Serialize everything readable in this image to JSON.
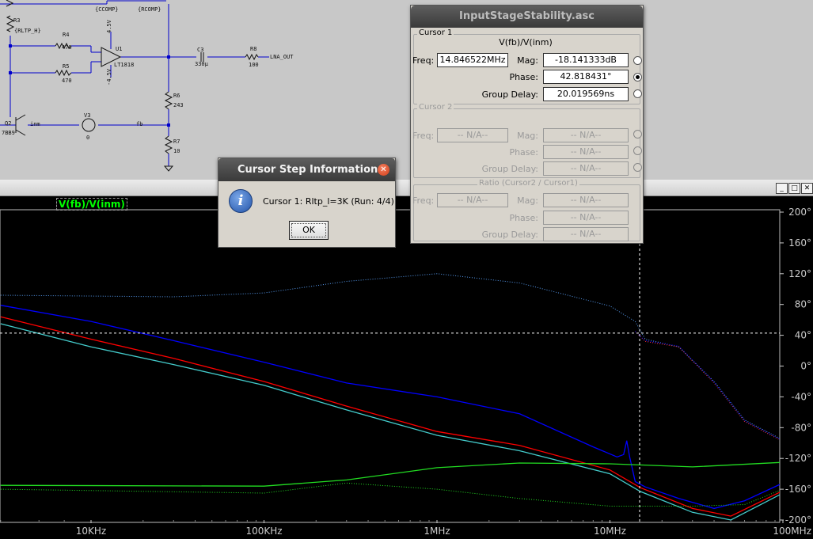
{
  "schematic": {
    "labels": {
      "r3": "R3",
      "rltp_h": "{RLTP_H}",
      "ccomp": "{CCOMP}",
      "rcomp": "{RCOMP}",
      "r4": "R4",
      "r4v": "470",
      "r5": "R5",
      "r5v": "470",
      "vp": "4.5V",
      "vn": "-4.5V",
      "u1": "U1",
      "u1part": "LT1818",
      "c3": "C3",
      "c3v": "330µ",
      "r8": "R8",
      "r8v": "100",
      "lna_out": "LNA_OUT",
      "r6": "R6",
      "r6v": "243",
      "r7": "R7",
      "r7v": "10",
      "q2": "Q2",
      "q2part": "7BB9",
      "inm": "inm",
      "v3": "V3",
      "v3v": "0",
      "fb": "fb"
    }
  },
  "wave_window": {
    "trace_label": "V(fb)/V(inm)",
    "buttons": {
      "minimize": "_",
      "maximize": "□",
      "close": "✕"
    }
  },
  "cursor_dialog": {
    "title": "InputStageStability.asc",
    "cursor1": {
      "group_title": "Cursor 1",
      "expr": "V(fb)/V(inm)",
      "freq_label": "Freq:",
      "freq_value": "14.846522MHz",
      "mag_label": "Mag:",
      "mag_value": "-18.141333dB",
      "phase_label": "Phase:",
      "phase_value": "42.818431°",
      "gd_label": "Group Delay:",
      "gd_value": "20.019569ns"
    },
    "cursor2": {
      "group_title": "Cursor 2",
      "freq_label": "Freq:",
      "freq_value": "-- N/A--",
      "mag_label": "Mag:",
      "mag_value": "-- N/A--",
      "phase_label": "Phase:",
      "phase_value": "-- N/A--",
      "gd_label": "Group Delay:",
      "gd_value": "-- N/A--"
    },
    "ratio": {
      "group_title": "Ratio (Cursor2 / Cursor1)",
      "freq_label": "Freq:",
      "freq_value": "-- N/A--",
      "mag_label": "Mag:",
      "mag_value": "-- N/A--",
      "phase_label": "Phase:",
      "phase_value": "-- N/A--",
      "gd_label": "Group Delay:",
      "gd_value": "-- N/A--"
    }
  },
  "step_dialog": {
    "title": "Cursor Step Information",
    "icon": "info-icon",
    "message": "Cursor 1: Rltp_l=3K  (Run: 4/4)",
    "ok_label": "OK",
    "close_glyph": "✕"
  },
  "chart_data": {
    "type": "line",
    "x_scale": "log",
    "x_ticks": [
      "10KHz",
      "100KHz",
      "1MHz",
      "10MHz",
      "100MHz"
    ],
    "y_right_ticks": [
      "200°",
      "160°",
      "120°",
      "80°",
      "40°",
      "0°",
      "-40°",
      "-80°",
      "-120°",
      "-160°",
      "-200°"
    ],
    "y_right_range": [
      -200,
      200
    ],
    "cursor": {
      "freq_hz": 14846522,
      "phase_deg": 42.818431
    },
    "colors": {
      "background": "#000000",
      "grid": "#bbbbbb",
      "ticks": "#cccccc",
      "cursor": "#ffffff"
    },
    "series": [
      {
        "color": "#0000ff",
        "style": "solid",
        "points": [
          [
            3000,
            79
          ],
          [
            10000,
            58
          ],
          [
            30000,
            33
          ],
          [
            100000,
            5
          ],
          [
            300000,
            -22
          ],
          [
            1000000,
            -40
          ],
          [
            3000000,
            -62
          ],
          [
            8000000,
            -105
          ],
          [
            11000000,
            -118
          ],
          [
            12000000,
            -115
          ],
          [
            12500000,
            -97
          ],
          [
            13000000,
            -118
          ],
          [
            14000000,
            -150
          ],
          [
            16000000,
            -157
          ],
          [
            25000000,
            -172
          ],
          [
            40000000,
            -185
          ],
          [
            60000000,
            -175
          ],
          [
            100000000,
            -152
          ]
        ]
      },
      {
        "color": "#ff0000",
        "style": "solid",
        "points": [
          [
            3000,
            64
          ],
          [
            10000,
            35
          ],
          [
            30000,
            10
          ],
          [
            100000,
            -20
          ],
          [
            300000,
            -52
          ],
          [
            1000000,
            -85
          ],
          [
            3000000,
            -103
          ],
          [
            10000000,
            -135
          ],
          [
            15000000,
            -158
          ],
          [
            30000000,
            -185
          ],
          [
            50000000,
            -195
          ],
          [
            100000000,
            -162
          ]
        ]
      },
      {
        "color": "#44cccc",
        "style": "solid",
        "points": [
          [
            3000,
            55
          ],
          [
            10000,
            25
          ],
          [
            30000,
            2
          ],
          [
            100000,
            -25
          ],
          [
            300000,
            -57
          ],
          [
            1000000,
            -90
          ],
          [
            3000000,
            -110
          ],
          [
            10000000,
            -140
          ],
          [
            15000000,
            -163
          ],
          [
            30000000,
            -190
          ],
          [
            50000000,
            -200
          ],
          [
            100000000,
            -165
          ]
        ]
      },
      {
        "color": "#22dd22",
        "style": "solid",
        "points": [
          [
            3000,
            -155
          ],
          [
            100000,
            -156
          ],
          [
            300000,
            -148
          ],
          [
            1000000,
            -132
          ],
          [
            3000000,
            -126
          ],
          [
            10000000,
            -127
          ],
          [
            30000000,
            -131
          ],
          [
            100000000,
            -125
          ]
        ]
      },
      {
        "color": "#5599ee",
        "style": "dotted",
        "points": [
          [
            3000,
            92
          ],
          [
            30000,
            90
          ],
          [
            100000,
            95
          ],
          [
            300000,
            110
          ],
          [
            1000000,
            120
          ],
          [
            3000000,
            108
          ],
          [
            10000000,
            78
          ],
          [
            14000000,
            58
          ],
          [
            16000000,
            35
          ],
          [
            25000000,
            25
          ],
          [
            40000000,
            -20
          ],
          [
            60000000,
            -70
          ],
          [
            100000000,
            -96
          ]
        ]
      },
      {
        "color": "#ff3333",
        "style": "dotted",
        "points": [
          [
            14000000,
            45
          ],
          [
            16000000,
            32
          ],
          [
            25000000,
            25
          ],
          [
            40000000,
            -22
          ],
          [
            60000000,
            -72
          ],
          [
            100000000,
            -98
          ]
        ]
      },
      {
        "color": "#0000ff",
        "style": "dotted",
        "points": [
          [
            14000000,
            45
          ],
          [
            16000000,
            33
          ],
          [
            25000000,
            26
          ],
          [
            40000000,
            -21
          ],
          [
            60000000,
            -71
          ],
          [
            100000000,
            -97
          ]
        ]
      },
      {
        "color": "#22dd22",
        "style": "dotted",
        "points": [
          [
            3000,
            -160
          ],
          [
            100000,
            -165
          ],
          [
            300000,
            -152
          ],
          [
            1000000,
            -160
          ],
          [
            3000000,
            -172
          ],
          [
            10000000,
            -182
          ],
          [
            30000000,
            -182
          ],
          [
            60000000,
            -180
          ],
          [
            100000000,
            -160
          ]
        ]
      }
    ]
  }
}
